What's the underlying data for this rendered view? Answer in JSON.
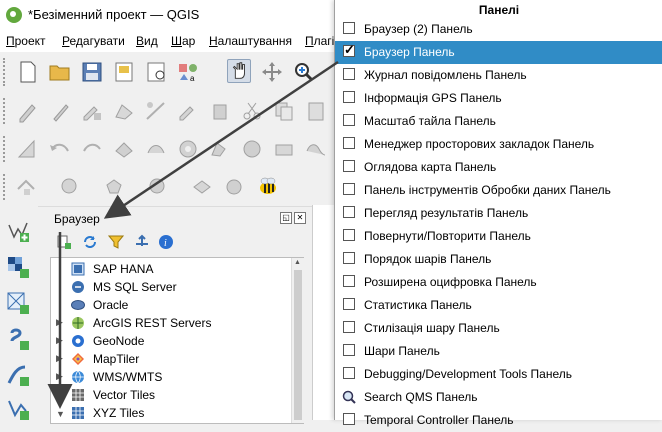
{
  "window": {
    "title": "*Безіменний проект — QGIS"
  },
  "menubar": {
    "items": [
      {
        "label": "Проект",
        "u": "П"
      },
      {
        "label": "Редагувати",
        "u": "Р"
      },
      {
        "label": "Вид",
        "u": "В"
      },
      {
        "label": "Шар",
        "u": "Ш"
      },
      {
        "label": "Налаштування",
        "u": "Н"
      },
      {
        "label": "Плагі",
        "u": "П"
      }
    ]
  },
  "browser_panel": {
    "title": "Браузер",
    "items": [
      {
        "label": "SAP HANA",
        "icon": "sap-hana-icon"
      },
      {
        "label": "MS SQL Server",
        "icon": "mssql-icon"
      },
      {
        "label": "Oracle",
        "icon": "oracle-icon"
      },
      {
        "label": "ArcGIS REST Servers",
        "icon": "arcgis-icon"
      },
      {
        "label": "GeoNode",
        "icon": "geonode-icon"
      },
      {
        "label": "MapTiler",
        "icon": "maptiler-icon"
      },
      {
        "label": "WMS/WMTS",
        "icon": "wms-icon"
      },
      {
        "label": "Vector Tiles",
        "icon": "vector-tiles-icon"
      },
      {
        "label": "XYZ Tiles",
        "icon": "xyz-tiles-icon"
      }
    ]
  },
  "panels_menu": {
    "title": "Панелі",
    "items": [
      {
        "label": "Браузер (2) Панель",
        "checked": false,
        "selected": false
      },
      {
        "label": "Браузер Панель",
        "checked": true,
        "selected": true
      },
      {
        "label": "Журнал повідомлень Панель",
        "checked": false,
        "selected": false
      },
      {
        "label": "Інформація GPS Панель",
        "checked": false,
        "selected": false
      },
      {
        "label": "Масштаб тайла Панель",
        "checked": false,
        "selected": false
      },
      {
        "label": "Менеджер просторових закладок Панель",
        "checked": false,
        "selected": false
      },
      {
        "label": "Оглядова карта Панель",
        "checked": false,
        "selected": false
      },
      {
        "label": "Панель інструментів Обробки даних Панель",
        "checked": false,
        "selected": false
      },
      {
        "label": "Перегляд результатів Панель",
        "checked": false,
        "selected": false
      },
      {
        "label": "Повернути/Повторити Панель",
        "checked": false,
        "selected": false
      },
      {
        "label": "Порядок шарів Панель",
        "checked": false,
        "selected": false
      },
      {
        "label": "Розширена оцифровка Панель",
        "checked": false,
        "selected": false
      },
      {
        "label": "Статистика Панель",
        "checked": false,
        "selected": false
      },
      {
        "label": "Стилізація шару Панель",
        "checked": false,
        "selected": false
      },
      {
        "label": "Шари Панель",
        "checked": false,
        "selected": false
      },
      {
        "label": "Debugging/Development Tools Панель",
        "checked": false,
        "selected": false
      },
      {
        "label": "Search QMS Панель",
        "checked": false,
        "selected": false,
        "icon": "search-qms-icon"
      },
      {
        "label": "Temporal Controller Панель",
        "checked": false,
        "selected": false
      }
    ]
  },
  "colors": {
    "selection": "#308cc6",
    "qgis_green": "#62a83d"
  }
}
